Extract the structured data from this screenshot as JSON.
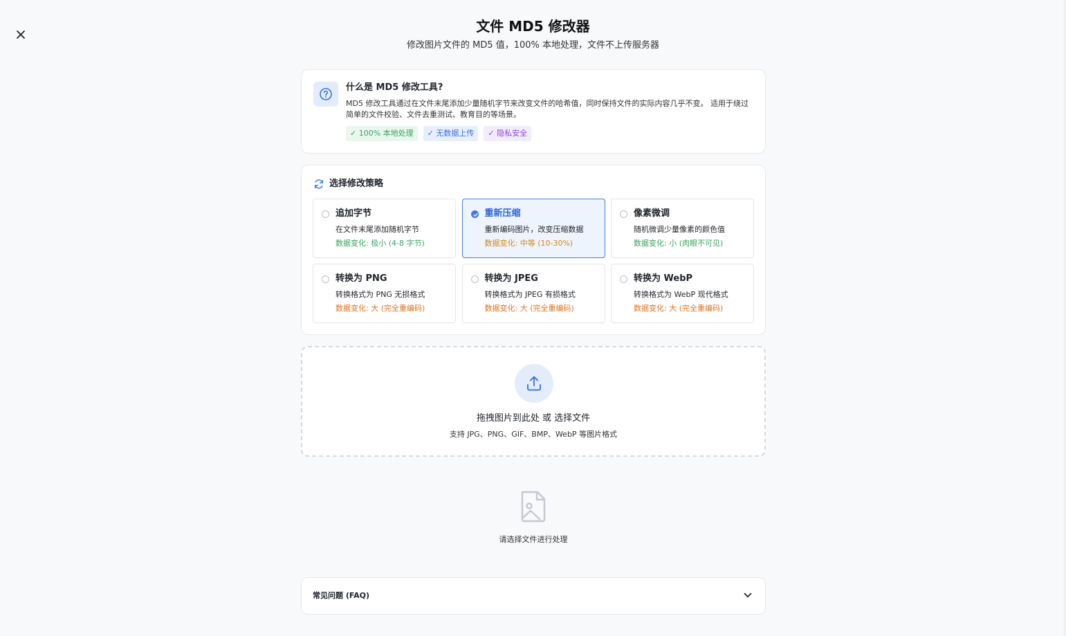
{
  "header": {
    "title": "文件 MD5 修改器",
    "subtitle": "修改图片文件的 MD5 值，100% 本地处理，文件不上传服务器"
  },
  "info": {
    "icon": "help-circle-icon",
    "title": "什么是 MD5 修改工具?",
    "description": "MD5 修改工具通过在文件末尾添加少量随机字节来改变文件的哈希值，同时保持文件的实际内容几乎不变。 适用于绕过简单的文件校验、文件去重测试、教育目的等场景。",
    "tags": [
      {
        "label": "✓ 100% 本地处理",
        "color": "#3aa45f"
      },
      {
        "label": "✓ 无数据上传",
        "color": "#3d6ee0"
      },
      {
        "label": "✓ 隐私安全",
        "color": "#8a46d8"
      }
    ]
  },
  "strategy": {
    "icon": "refresh-icon",
    "title": "选择修改策略",
    "selected": "重新压缩",
    "options": [
      {
        "name": "追加字节",
        "desc": "在文件末尾添加随机字节",
        "change": "数据变化: 极小 (4-8 字节)",
        "level": "green"
      },
      {
        "name": "重新压缩",
        "desc": "重新编码图片，改变压缩数据",
        "change": "数据变化: 中等 (10-30%)",
        "level": "amber"
      },
      {
        "name": "像素微调",
        "desc": "随机微调少量像素的颜色值",
        "change": "数据变化: 小 (肉眼不可见)",
        "level": "green"
      },
      {
        "name": "转换为 PNG",
        "desc": "转换格式为 PNG 无损格式",
        "change": "数据变化: 大 (完全重编码)",
        "level": "orange"
      },
      {
        "name": "转换为 JPEG",
        "desc": "转换格式为 JPEG 有损格式",
        "change": "数据变化: 大 (完全重编码)",
        "level": "orange"
      },
      {
        "name": "转换为 WebP",
        "desc": "转换格式为 WebP 现代格式",
        "change": "数据变化: 大 (完全重编码)",
        "level": "orange"
      }
    ]
  },
  "upload": {
    "icon": "upload-icon",
    "main_text": "拖拽图片到此处 或 选择文件",
    "hint": "支持 JPG、PNG、GIF、BMP、WebP 等图片格式"
  },
  "empty_state": {
    "icon": "image-file-icon",
    "text": "请选择文件进行处理"
  },
  "faq": {
    "title": "常见问题 (FAQ)",
    "icon": "chevron-down-icon"
  },
  "colors": {
    "accent": "#3f7be6",
    "green": "#3aa45f",
    "amber": "#d08a1a",
    "orange": "#e0731c"
  }
}
